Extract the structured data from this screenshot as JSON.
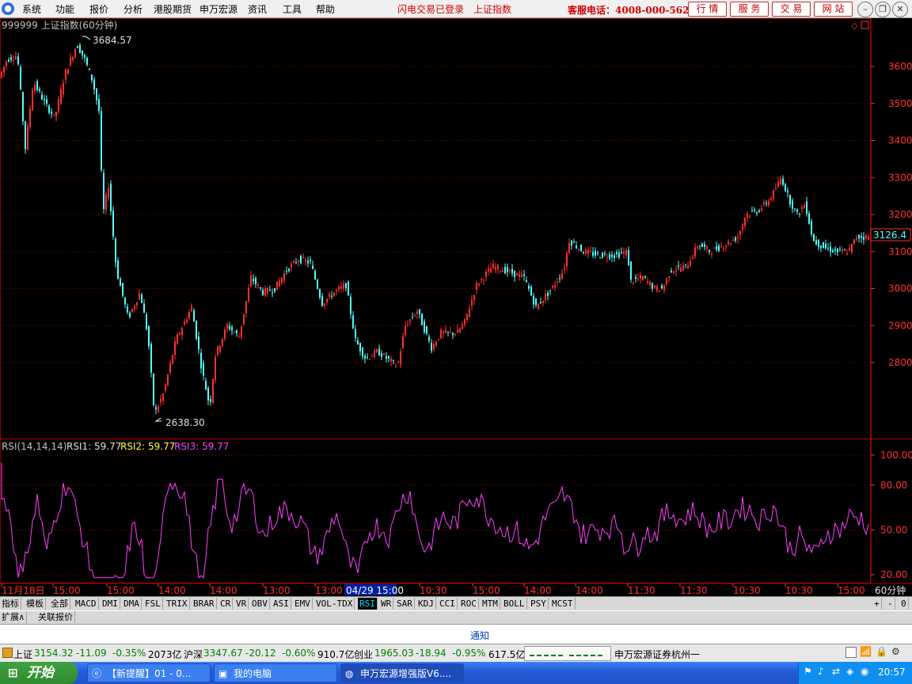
{
  "menubar": {
    "items": [
      "系统",
      "功能",
      "报价",
      "分析",
      "港股期货",
      "申万宏源",
      "资讯",
      "工具",
      "帮助"
    ],
    "login_status": "闪电交易已登录",
    "current_security": "上证指数",
    "hotline": "客服电话：4008-000-562",
    "nav_buttons": [
      "行 情",
      "服 务",
      "交 易",
      "网 站"
    ]
  },
  "main_chart": {
    "header": "999999 上证指数(60分钟)",
    "high_label": "3684.57",
    "low_label": "2638.30",
    "price_tag": "3126.4",
    "y_ticks": [
      "3600",
      "3500",
      "3400",
      "3300",
      "3200",
      "3100",
      "3000",
      "2900",
      "2800"
    ]
  },
  "rsi_chart": {
    "header_name": "RSI(14,14,14)",
    "rsi1": "RSI1: 59.77",
    "rsi2": "RSI2: 59.77",
    "rsi3": "RSI3: 59.77",
    "y_ticks": [
      "100.00",
      "80.00",
      "50.00",
      "20.00"
    ]
  },
  "x_axis": {
    "labels": [
      "11月18日",
      "15:00",
      "15:00",
      "14:00",
      "14:00",
      "13:00",
      "13:00",
      "04/29 15:00",
      "10:30",
      "15:00",
      "14:00",
      "14:00",
      "11:30",
      "11:30",
      "10:30",
      "10:30",
      "15:00"
    ],
    "period": "60分钟"
  },
  "indicator_tabs": [
    "指标",
    "模板",
    "全部",
    "MACD",
    "DMI",
    "DMA",
    "FSL",
    "TRIX",
    "BRAR",
    "CR",
    "VR",
    "OBV",
    "ASI",
    "EMV",
    "VOL-TDX",
    "RSI",
    "WR",
    "SAR",
    "KDJ",
    "CCI",
    "ROC",
    "MTM",
    "BOLL",
    "PSY",
    "MCST"
  ],
  "active_tab": "RSI",
  "tab_controls": [
    "+",
    "-",
    "0"
  ],
  "sub_tabs": [
    "扩展∧",
    "关联报价"
  ],
  "notice": "通知",
  "status": {
    "sh_label": "上证",
    "sh_value": "3154.32",
    "sh_change": "-11.09",
    "sh_pct": "-0.35%",
    "sh_amount": "2073亿",
    "hs_label": "沪深",
    "hs_value": "3347.67",
    "hs_change": "-20.12",
    "hs_pct": "-0.60%",
    "hs_amount": "910.7亿",
    "cy_label": "创业",
    "cy_value": "1965.03",
    "cy_change": "-18.94",
    "cy_pct": "-0.95%",
    "cy_amount": "617.5亿",
    "broker": "申万宏源证券杭州一"
  },
  "taskbar": {
    "start": "开始",
    "tasks": [
      "【新提醒】01 - 0...",
      "我的电脑",
      "申万宏源增强版V6...."
    ],
    "clock": "20:57"
  },
  "colors": {
    "up": "#ff3030",
    "down": "#54ffff",
    "rsi": "#ff40ff",
    "grid": "#8b0000"
  }
}
